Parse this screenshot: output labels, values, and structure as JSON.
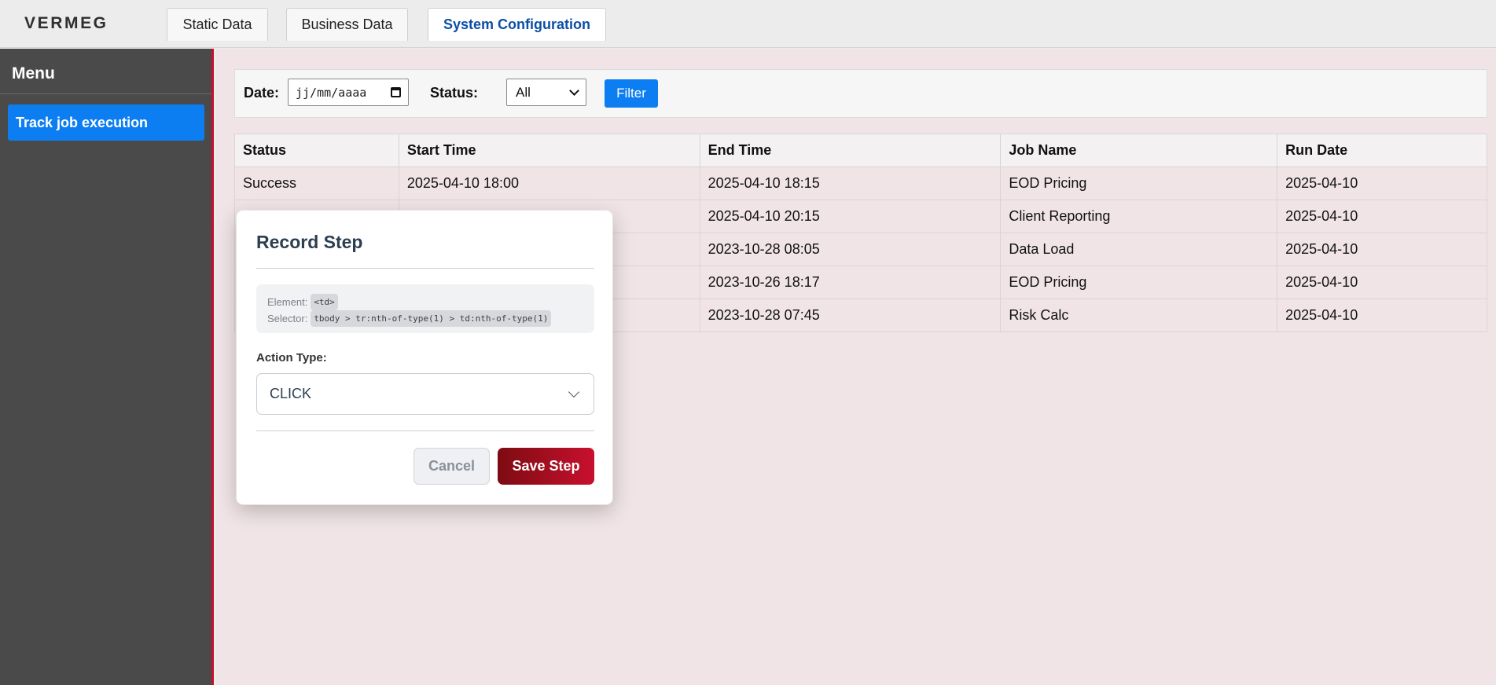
{
  "header": {
    "logo": "VERMEG",
    "tabs": [
      {
        "label": "Static Data",
        "active": false
      },
      {
        "label": "Business Data",
        "active": false
      },
      {
        "label": "System Configuration",
        "active": true
      }
    ]
  },
  "sidebar": {
    "title": "Menu",
    "items": [
      {
        "label": "Track job execution",
        "active": true
      }
    ]
  },
  "filters": {
    "date_label": "Date:",
    "date_placeholder": "jj/mm/aaaa",
    "status_label": "Status:",
    "status_value": "All",
    "filter_button": "Filter"
  },
  "table": {
    "columns": [
      "Status",
      "Start Time",
      "End Time",
      "Job Name",
      "Run Date"
    ],
    "rows": [
      [
        "Success",
        "2025-04-10 18:00",
        "2025-04-10 18:15",
        "EOD Pricing",
        "2025-04-10"
      ],
      [
        "",
        "",
        "2025-04-10 20:15",
        "Client Reporting",
        "2025-04-10"
      ],
      [
        "",
        "",
        "2023-10-28 08:05",
        "Data Load",
        "2025-04-10"
      ],
      [
        "",
        "",
        "2023-10-26 18:17",
        "EOD Pricing",
        "2025-04-10"
      ],
      [
        "",
        "",
        "2023-10-28 07:45",
        "Risk Calc",
        "2025-04-10"
      ]
    ]
  },
  "dialog": {
    "title": "Record Step",
    "element_label": "Element:",
    "element_value": "<td>",
    "selector_label": "Selector:",
    "selector_value": "tbody > tr:nth-of-type(1) > td:nth-of-type(1)",
    "action_type_label": "Action Type:",
    "action_type_value": "CLICK",
    "cancel_button": "Cancel",
    "save_button": "Save Step"
  },
  "colors": {
    "accent_blue": "#0d7ef2",
    "brand_red": "#c8102e",
    "sidebar_bg": "#4a4a4a",
    "main_bg": "#f0e4e6"
  }
}
